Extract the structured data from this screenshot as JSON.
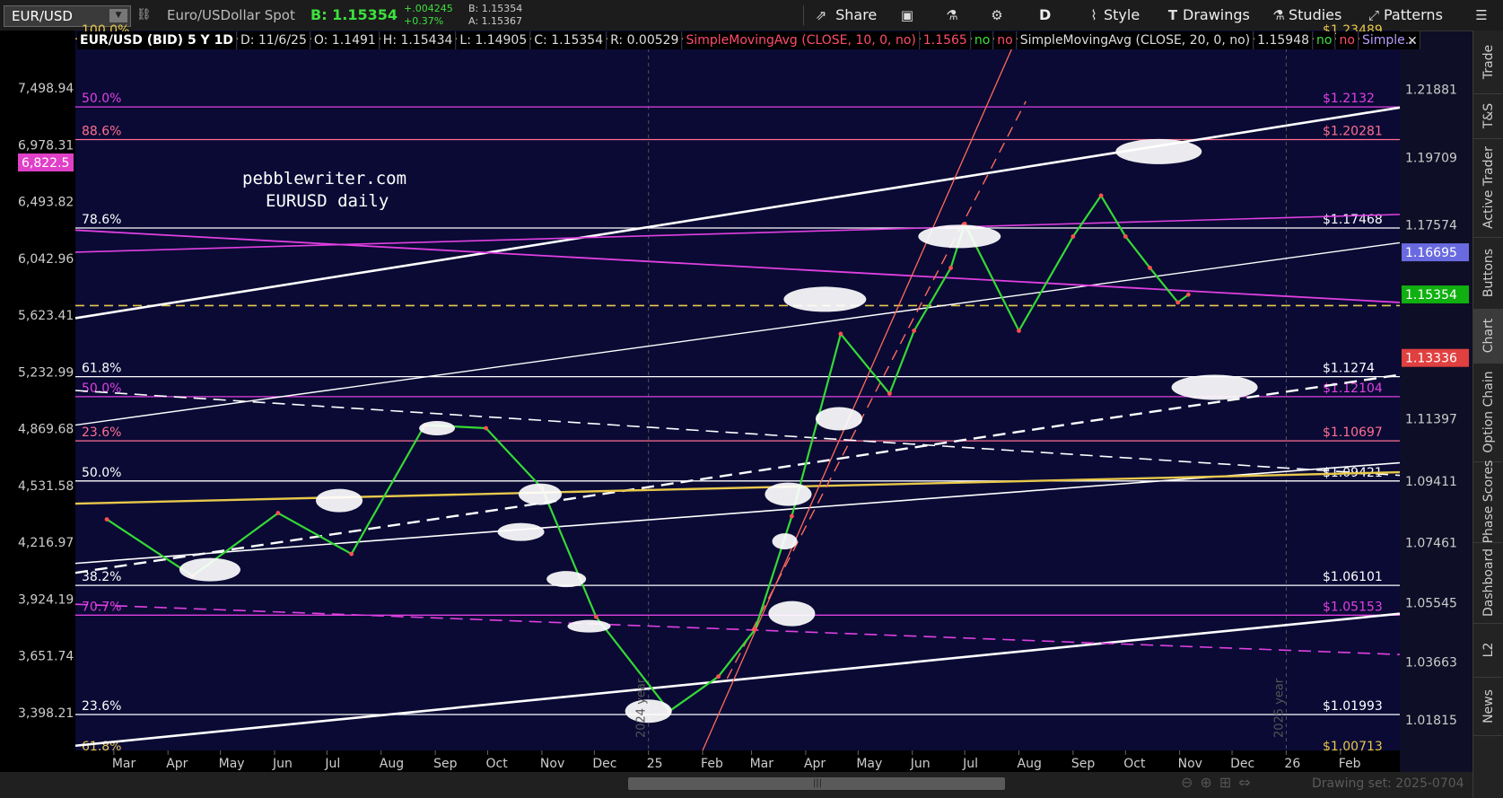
{
  "toolbar": {
    "symbol": "EUR/USD",
    "description": "Euro/USDollar Spot",
    "bid": "B: 1.15354",
    "change": "+.004245",
    "change_pct": "+0.37%",
    "bid_small": "B: 1.15354",
    "ask_small": "A: 1.15367",
    "share": "Share",
    "timeframe": "D",
    "style": "Style",
    "drawings": "Drawings",
    "studies": "Studies",
    "patterns": "Patterns"
  },
  "info_bar": {
    "title": "EUR/USD (BID) 5 Y 1D",
    "date": "D: 11/6/25",
    "open": "O: 1.1491",
    "high": "H: 1.15434",
    "low": "L: 1.14905",
    "close": "C: 1.15354",
    "range": "R: 0.00529",
    "sma10_label": "SimpleMovingAvg (CLOSE, 10, 0, no)",
    "sma10_value": "1.1565",
    "no1": "no",
    "no2": "no",
    "sma20_label": "SimpleMovingAvg (CLOSE, 20, 0, no)",
    "sma20_value": "1.15948",
    "no3": "no",
    "no4": "no",
    "more": "Simple..."
  },
  "watermark": [
    "pebblewriter.com",
    "EURUSD daily"
  ],
  "left_axis": [
    {
      "label": "7,498.94",
      "pos": 0
    },
    {
      "label": "6,978.31",
      "pos": 0
    },
    {
      "label": "6,493.82",
      "pos": 0
    },
    {
      "label": "6,042.96",
      "pos": 0
    },
    {
      "label": "5,623.41",
      "pos": 0
    },
    {
      "label": "5,232.99",
      "pos": 0
    },
    {
      "label": "4,869.68",
      "pos": 0
    },
    {
      "label": "4,531.58",
      "pos": 0
    },
    {
      "label": "4,216.97",
      "pos": 0
    },
    {
      "label": "3,924.19",
      "pos": 0
    },
    {
      "label": "3,651.74",
      "pos": 0
    },
    {
      "label": "3,398.21",
      "pos": 0
    }
  ],
  "left_marker": {
    "label": "6,822.5",
    "color": "#e040c8"
  },
  "right_axis": [
    {
      "label": "1.21881",
      "value": 1.21881
    },
    {
      "label": "1.19709",
      "value": 1.19709
    },
    {
      "label": "1.17574",
      "value": 1.17574
    },
    {
      "label": "1.11397",
      "value": 1.11397
    },
    {
      "label": "1.09411",
      "value": 1.09411
    },
    {
      "label": "1.07461",
      "value": 1.07461
    },
    {
      "label": "1.05545",
      "value": 1.05545
    },
    {
      "label": "1.03663",
      "value": 1.03663
    },
    {
      "label": "1.01815",
      "value": 1.01815
    }
  ],
  "price_tags": [
    {
      "label": "1.16695",
      "value": 1.16695,
      "bg": "#6a6ae0",
      "fg": "#ffffff"
    },
    {
      "label": "1.15354",
      "value": 1.15354,
      "bg": "#10b010",
      "fg": "#ffffff"
    },
    {
      "label": "1.13336",
      "value": 1.13336,
      "bg": "#e04040",
      "fg": "#ffffff"
    }
  ],
  "fib_levels": [
    {
      "left": "100.0%",
      "right": "$1.23489",
      "value": 1.23489,
      "color": "#e8c84a"
    },
    {
      "left": "50.0%",
      "right": "$1.2132",
      "value": 1.2132,
      "color": "#e040e0"
    },
    {
      "left": "88.6%",
      "right": "$1.20281",
      "value": 1.2028,
      "color": "#ff7090"
    },
    {
      "left": "78.6%",
      "right": "$1.17468",
      "value": 1.17468,
      "color": "#ffffff"
    },
    {
      "left": "61.8%",
      "right": "$1.1274",
      "value": 1.1274,
      "color": "#ffffff"
    },
    {
      "left": "50.0%",
      "right": "$1.12104",
      "value": 1.12104,
      "color": "#e040e0"
    },
    {
      "left": "23.6%",
      "right": "$1.10697",
      "value": 1.10697,
      "color": "#ff7090"
    },
    {
      "left": "50.0%",
      "right": "$1.09421",
      "value": 1.09421,
      "color": "#ffffff"
    },
    {
      "left": "38.2%",
      "right": "$1.06101",
      "value": 1.06101,
      "color": "#ffffff"
    },
    {
      "left": "70.7%",
      "right": "$1.05153",
      "value": 1.05153,
      "color": "#e040e0"
    },
    {
      "left": "23.6%",
      "right": "$1.01993",
      "value": 1.01993,
      "color": "#ffffff"
    },
    {
      "left": "61.8%",
      "right": "$1.00713",
      "value": 1.00713,
      "color": "#e8c84a"
    }
  ],
  "x_axis": [
    {
      "label": "Mar",
      "day": 0
    },
    {
      "label": "Apr",
      "day": 0
    },
    {
      "label": "May",
      "day": 0
    },
    {
      "label": "Jun",
      "day": 0
    },
    {
      "label": "Jul",
      "day": 0
    },
    {
      "label": "Aug",
      "day": 0
    },
    {
      "label": "Sep",
      "day": 0
    },
    {
      "label": "Oct",
      "day": 0
    },
    {
      "label": "Nov",
      "day": 0
    },
    {
      "label": "Dec",
      "day": 0
    },
    {
      "label": "25",
      "day": 0
    },
    {
      "label": "Feb",
      "day": 0
    },
    {
      "label": "Mar",
      "day": 0
    },
    {
      "label": "Apr",
      "day": 0
    },
    {
      "label": "May",
      "day": 0
    },
    {
      "label": "Jun",
      "day": 0
    },
    {
      "label": "Jul",
      "day": 0
    },
    {
      "label": "Aug",
      "day": 0
    },
    {
      "label": "Sep",
      "day": 0
    },
    {
      "label": "Oct",
      "day": 0
    },
    {
      "label": "Nov",
      "day": 0
    },
    {
      "label": "Dec",
      "day": 0
    },
    {
      "label": "26",
      "day": 0
    },
    {
      "label": "Feb",
      "day": 0
    }
  ],
  "year_labels": [
    "2024 year",
    "2025 year"
  ],
  "right_tabs": [
    "Trade",
    "T&S",
    "Active Trader",
    "Buttons",
    "Chart",
    "Option Chain",
    "Phase Scores",
    "Dashboard",
    "L2",
    "News"
  ],
  "drawing_set": "Drawing set: 2025-0704",
  "chart_data": {
    "type": "line",
    "title": "EUR/USD (BID) 5 Y 1D",
    "price_axis_range": [
      1.0085,
      1.2375
    ],
    "series": [
      {
        "name": "EUR/USD",
        "x": [
          "2024-02-26",
          "2024-04-15",
          "2024-06-03",
          "2024-07-15",
          "2024-08-26",
          "2024-09-30",
          "2024-11-01",
          "2024-12-02",
          "2025-01-13",
          "2025-02-10",
          "2025-03-03",
          "2025-03-24",
          "2025-04-21",
          "2025-05-19",
          "2025-06-02",
          "2025-06-23",
          "2025-07-01",
          "2025-08-01",
          "2025-09-01",
          "2025-09-17",
          "2025-10-01",
          "2025-10-15",
          "2025-10-31",
          "2025-11-06"
        ],
        "values": [
          1.082,
          1.064,
          1.084,
          1.071,
          1.112,
          1.111,
          1.092,
          1.051,
          1.021,
          1.032,
          1.047,
          1.083,
          1.141,
          1.122,
          1.142,
          1.162,
          1.176,
          1.142,
          1.172,
          1.185,
          1.172,
          1.162,
          1.151,
          1.1535
        ]
      }
    ]
  }
}
